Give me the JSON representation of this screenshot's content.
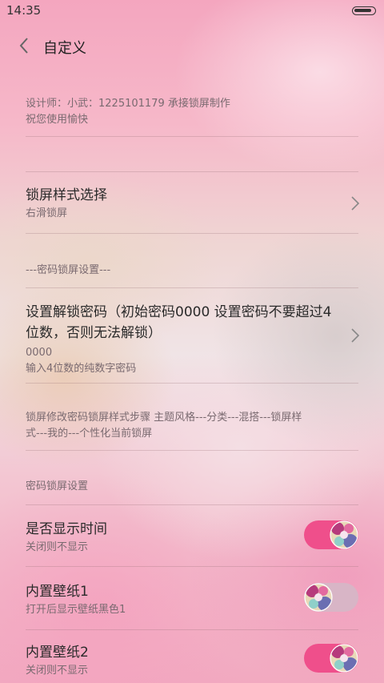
{
  "status": {
    "time": "14:35"
  },
  "header": {
    "title": "自定义"
  },
  "designer": {
    "line1": "设计师：小武：1225101179  承接锁屏制作",
    "line2": "祝您使用愉快"
  },
  "lock_style": {
    "title": "锁屏样式选择",
    "value": "右滑锁屏"
  },
  "password_section_label": "---密码锁屏设置---",
  "password": {
    "title_line1": "设置解锁密码（初始密码0000  设置密码不要超过4",
    "title_line2": "位数，否则无法解锁）",
    "value": "0000",
    "hint": "输入4位数的纯数字密码"
  },
  "steps": {
    "line1": "锁屏修改密码锁屏样式步骤  主题风格---分类---混搭---锁屏样",
    "line2": "式---我的---个性化当前锁屏"
  },
  "settings_category": "密码锁屏设置",
  "show_time": {
    "title": "是否显示时间",
    "sub": "关闭则不显示",
    "state": "on"
  },
  "wallpaper1": {
    "title": "内置壁纸1",
    "sub": "打开后显示壁纸黑色1",
    "state": "off"
  },
  "wallpaper2": {
    "title": "内置壁纸2",
    "sub": "关闭则不显示",
    "state": "on"
  },
  "colors": {
    "toggle_on": "#ef4f8b",
    "toggle_off": "#d8b5c6"
  }
}
